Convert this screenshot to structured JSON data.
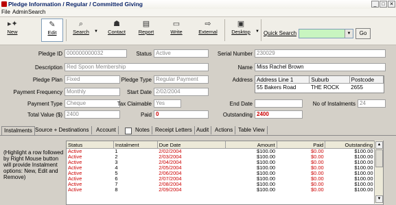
{
  "window": {
    "title": "Pledge Information / Regular / Committed Giving",
    "buttons": [
      "_",
      "□",
      "✕"
    ]
  },
  "menu": [
    "File",
    "Admin",
    "Search"
  ],
  "toolbar": {
    "buttons": [
      {
        "label": "New",
        "icon": "new-icon"
      },
      {
        "label": "Edit",
        "icon": "edit-icon"
      },
      {
        "label": "Search",
        "icon": "search-icon"
      },
      {
        "label": "Contact",
        "icon": "contact-icon"
      },
      {
        "label": "Report",
        "icon": "report-icon"
      },
      {
        "label": "Write",
        "icon": "write-icon"
      },
      {
        "label": "External",
        "icon": "external-icon"
      },
      {
        "label": "Desktop",
        "icon": "desktop-icon"
      }
    ],
    "quick_search_label": "Quick Search",
    "go_label": "Go"
  },
  "form": {
    "pledge_id_label": "Pledge ID",
    "pledge_id": "000000000032",
    "status_label": "Status",
    "status": "Active",
    "serial_number_label": "Serial Number",
    "serial_number": "230029",
    "description_label": "Description",
    "description": "Red Spoon Membership",
    "name_label": "Name",
    "name": "Miss Rachel Brown",
    "pledge_plan_label": "Pledge Plan",
    "pledge_plan": "Fixed",
    "pledge_type_label": "Pledge Type",
    "pledge_type": "Regular Payment",
    "address_label": "Address",
    "address_headers": [
      "Address Line 1",
      "Suburb",
      "Postcode"
    ],
    "address_row": [
      "55 Bakers Road",
      "THE ROCK",
      "2655"
    ],
    "payment_frequency_label": "Payment Frequency",
    "payment_frequency": "Monthly",
    "start_date_label": "Start Date",
    "start_date": "2/02/2004",
    "payment_type_label": "Payment Type",
    "payment_type": "Cheque",
    "tax_claimable_label": "Tax Claimable",
    "tax_claimable": "Yes",
    "end_date_label": "End Date",
    "end_date": "",
    "no_instalments_label": "No of Instalments",
    "no_instalments": "24",
    "total_value_label": "Total Value ($)",
    "total_value": "2400",
    "paid_label": "Paid",
    "paid": "0",
    "outstanding_label": "Outstanding",
    "outstanding": "2400"
  },
  "tabs": [
    "Instalments",
    "Source + Destinations",
    "Account",
    "Notes",
    "Receipt Letters",
    "Audit",
    "Actions",
    "Table View"
  ],
  "hint": "(Highlight a row followed by Right Mouse button will provide Instalment options: New, Edit and Remove)",
  "grid": {
    "headers": [
      "Status",
      "Instalment",
      "Due Date",
      "Amount",
      "Paid",
      "Outstanding"
    ],
    "rows": [
      [
        "Active",
        "1",
        "2/02/2004",
        "$100.00",
        "$0.00",
        "$100.00"
      ],
      [
        "Active",
        "2",
        "2/03/2004",
        "$100.00",
        "$0.00",
        "$100.00"
      ],
      [
        "Active",
        "3",
        "2/04/2004",
        "$100.00",
        "$0.00",
        "$100.00"
      ],
      [
        "Active",
        "4",
        "2/05/2004",
        "$100.00",
        "$0.00",
        "$100.00"
      ],
      [
        "Active",
        "5",
        "2/06/2004",
        "$100.00",
        "$0.00",
        "$100.00"
      ],
      [
        "Active",
        "6",
        "2/07/2004",
        "$100.00",
        "$0.00",
        "$100.00"
      ],
      [
        "Active",
        "7",
        "2/08/2004",
        "$100.00",
        "$0.00",
        "$100.00"
      ],
      [
        "Active",
        "8",
        "2/09/2004",
        "$100.00",
        "$0.00",
        "$100.00"
      ]
    ]
  }
}
